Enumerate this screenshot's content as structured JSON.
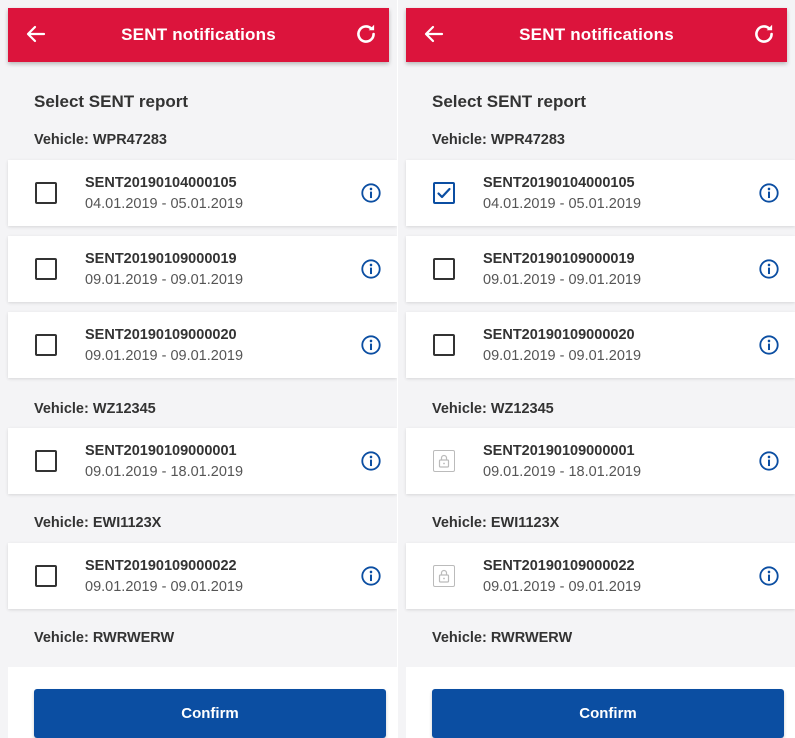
{
  "screens": [
    {
      "appbar": {
        "title": "SENT notifications"
      },
      "section_title": "Select SENT report",
      "vehicles": [
        {
          "label": "Vehicle: WPR47283",
          "reports": [
            {
              "id": "SENT20190104000105",
              "dates": "04.01.2019 - 05.01.2019",
              "state": "unchecked"
            },
            {
              "id": "SENT20190109000019",
              "dates": "09.01.2019 - 09.01.2019",
              "state": "unchecked"
            },
            {
              "id": "SENT20190109000020",
              "dates": "09.01.2019 - 09.01.2019",
              "state": "unchecked"
            }
          ]
        },
        {
          "label": "Vehicle: WZ12345",
          "reports": [
            {
              "id": "SENT20190109000001",
              "dates": "09.01.2019 - 18.01.2019",
              "state": "unchecked"
            }
          ]
        },
        {
          "label": "Vehicle: EWI1123X",
          "reports": [
            {
              "id": "SENT20190109000022",
              "dates": "09.01.2019 - 09.01.2019",
              "state": "unchecked"
            }
          ]
        },
        {
          "label": "Vehicle: RWRWERW",
          "reports": []
        }
      ],
      "confirm_label": "Confirm"
    },
    {
      "appbar": {
        "title": "SENT notifications"
      },
      "section_title": "Select SENT report",
      "vehicles": [
        {
          "label": "Vehicle: WPR47283",
          "reports": [
            {
              "id": "SENT20190104000105",
              "dates": "04.01.2019 - 05.01.2019",
              "state": "checked"
            },
            {
              "id": "SENT20190109000019",
              "dates": "09.01.2019 - 09.01.2019",
              "state": "unchecked"
            },
            {
              "id": "SENT20190109000020",
              "dates": "09.01.2019 - 09.01.2019",
              "state": "unchecked"
            }
          ]
        },
        {
          "label": "Vehicle: WZ12345",
          "reports": [
            {
              "id": "SENT20190109000001",
              "dates": "09.01.2019 - 18.01.2019",
              "state": "locked"
            }
          ]
        },
        {
          "label": "Vehicle: EWI1123X",
          "reports": [
            {
              "id": "SENT20190109000022",
              "dates": "09.01.2019 - 09.01.2019",
              "state": "locked"
            }
          ]
        },
        {
          "label": "Vehicle: RWRWERW",
          "reports": []
        }
      ],
      "confirm_label": "Confirm"
    }
  ],
  "colors": {
    "appbar": "#dc143c",
    "primary": "#0b4ea2",
    "background": "#f4f4f6"
  },
  "icons": {
    "back": "arrow-left-icon",
    "refresh": "refresh-icon",
    "info": "info-icon",
    "lock": "lock-icon"
  }
}
